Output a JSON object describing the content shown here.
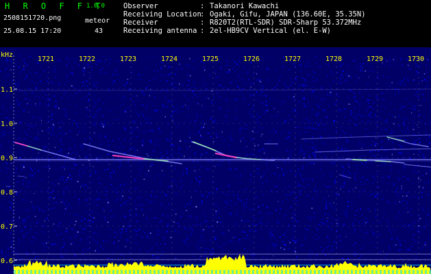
{
  "header": {
    "app_name": "H R O F F T",
    "app_version": "1.0.0",
    "filename": "2508151720.png",
    "datetime": "25.08.15 17:20",
    "meteor_label": "meteor",
    "meteor_count": "43"
  },
  "info": [
    {
      "label": "Observer",
      "value": "Takanori Kawachi"
    },
    {
      "label": "Receiving Location",
      "value": "Ogaki, Gifu, JAPAN (136.60E, 35.35N)"
    },
    {
      "label": "Receiver",
      "value": "R820T2(RTL-SDR) SDR-Sharp 53.372MHz"
    },
    {
      "label": "Receiving antenna",
      "value": "2el-HB9CV Vertical (el. E-W)"
    }
  ],
  "spectrogram": {
    "y_unit_label": "kHz",
    "y_ticks": [
      "1.1",
      "1.0",
      "0.9",
      "0.8",
      "0.7",
      "0.6"
    ],
    "x_ticks": [
      "1721",
      "1722",
      "1723",
      "1724",
      "1725",
      "1726",
      "1727",
      "1728",
      "1729",
      "1730"
    ],
    "y_range": [
      0.6,
      1.12
    ],
    "x_range": [
      1720.35,
      1730.35
    ],
    "colors": {
      "background": "#000066",
      "noise": "#0000ff",
      "trace": "#7f7fff",
      "trace_hot": "#9fff9f",
      "trace_peak": "#ff3fbf",
      "grid": "#ffffff",
      "axis_text": "#ffff00",
      "activity": "#ffff00",
      "baseline": "#00e0ff"
    },
    "ticks_dashed": true
  }
}
